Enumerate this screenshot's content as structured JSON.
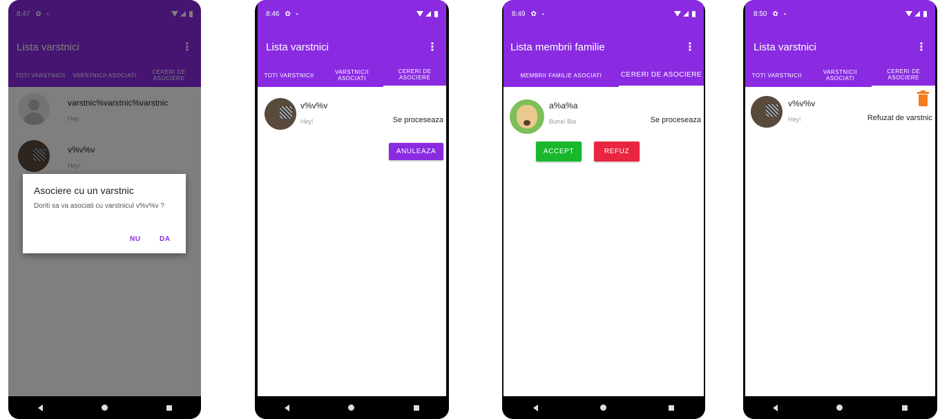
{
  "colors": {
    "primary": "#8a2be2",
    "accept_green": "#19b82c",
    "refuse_red": "#e8263f",
    "trash_orange": "#f57c1f"
  },
  "screens": [
    {
      "time": "8:47",
      "app_title": "Lista varstnici",
      "tabs": [
        "TOTI VARSTNICII",
        "VARSTNICII ASOCIATI",
        "CERERI DE ASOCIERE"
      ],
      "rows": [
        {
          "name": "varstnic%varstnic%varstnic",
          "message": "Hey"
        },
        {
          "name": "v%v%v",
          "message": "Hey!"
        }
      ],
      "dialog": {
        "title": "Asociere cu un varstnic",
        "message": "Doriti sa va asociati cu varstnicul v%v%v ?",
        "negative": "NU",
        "positive": "DA"
      }
    },
    {
      "time": "8:46",
      "app_title": "Lista varstnici",
      "tabs": [
        "TOTI VARSTNICII",
        "VARSTNICII ASOCIATI",
        "CERERI DE ASOCIERE"
      ],
      "row": {
        "name": "v%v%v",
        "message": "Hey!",
        "status": "Se proceseaza"
      },
      "cancel_button": "ANULEAZA"
    },
    {
      "time": "8:49",
      "app_title": "Lista membrii familie",
      "tabs": [
        "MEMBRII FAMILIE ASOCIATI",
        "CERERI DE ASOCIERE"
      ],
      "row": {
        "name": "a%a%a",
        "message": "Buna! Bia",
        "status": "Se proceseaza"
      },
      "accept_button": "ACCEPT",
      "refuse_button": "REFUZ"
    },
    {
      "time": "8:50",
      "app_title": "Lista varstnici",
      "tabs": [
        "TOTI VARSTNICII",
        "VARSTNICII ASOCIATI",
        "CERERI DE ASOCIERE"
      ],
      "row": {
        "name": "v%v%v",
        "message": "Hey!",
        "status": "Refuzat de varstnic"
      },
      "delete_icon": "trash-icon"
    }
  ],
  "status_icons": [
    "gear-icon",
    "wifi-icon",
    "signal-icon",
    "battery-icon"
  ],
  "nav_icons": [
    "back-icon",
    "home-icon",
    "recents-icon"
  ]
}
